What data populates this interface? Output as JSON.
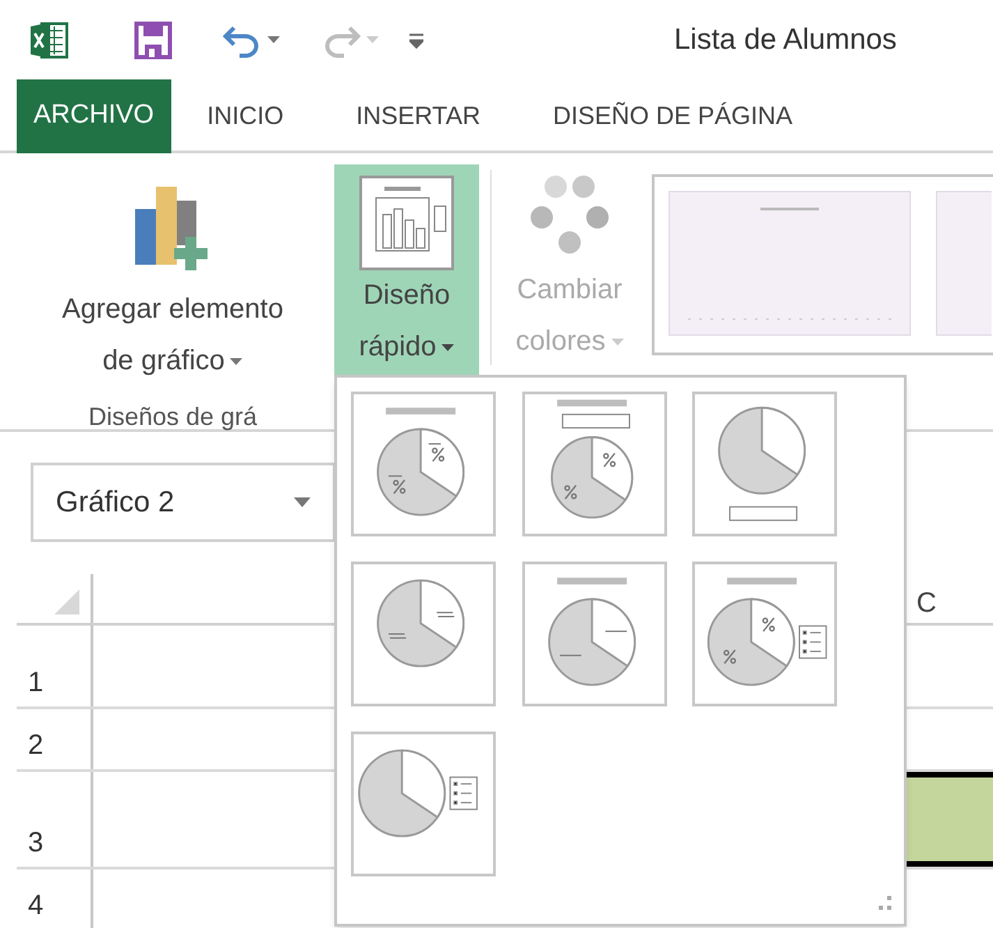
{
  "window": {
    "title": "Lista de Alumnos"
  },
  "tabs": [
    {
      "label": "ARCHIVO",
      "kind": "file",
      "selected": false
    },
    {
      "label": "INICIO",
      "kind": "tab",
      "selected": false
    },
    {
      "label": "INSERTAR",
      "kind": "tab",
      "selected": false
    },
    {
      "label": "DISEÑO DE PÁGINA",
      "kind": "tab",
      "selected": false
    }
  ],
  "ribbon": {
    "add_element": {
      "line1": "Agregar elemento",
      "line2": "de gráfico"
    },
    "quick_layout": {
      "line1": "Diseño",
      "line2": "rápido",
      "selected": true
    },
    "change_colors": {
      "line1": "Cambiar",
      "line2": "colores",
      "disabled": true
    },
    "group_label": "Diseños de grá"
  },
  "name_box": {
    "value": "Gráfico 2"
  },
  "sheet": {
    "column_header": "C",
    "rows": [
      "1",
      "2",
      "3",
      "4"
    ]
  },
  "quick_layouts": [
    {
      "kind": "title_percent"
    },
    {
      "kind": "title_banner_percent"
    },
    {
      "kind": "bottom_banner"
    },
    {
      "kind": "lines"
    },
    {
      "kind": "title_lines"
    },
    {
      "kind": "title_percent_legend"
    },
    {
      "kind": "legend"
    }
  ]
}
